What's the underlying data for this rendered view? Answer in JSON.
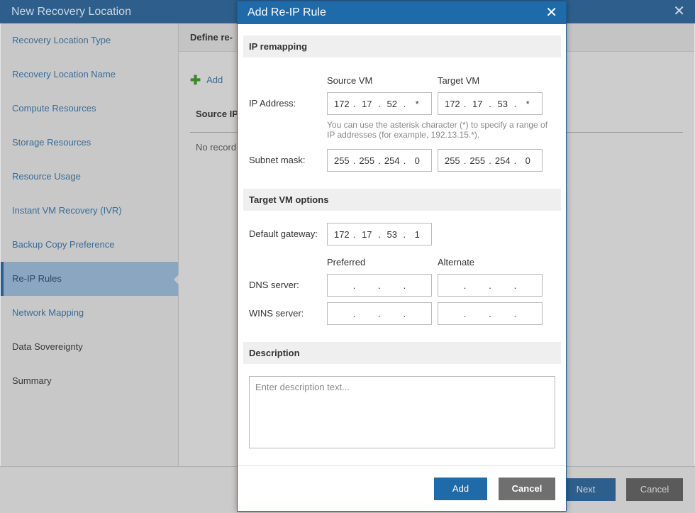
{
  "wizard": {
    "title": "New Recovery Location",
    "close_glyph": "✕",
    "steps": [
      {
        "label": "Recovery Location Type",
        "state": "link"
      },
      {
        "label": "Recovery Location Name",
        "state": "link"
      },
      {
        "label": "Compute Resources",
        "state": "link"
      },
      {
        "label": "Storage Resources",
        "state": "link"
      },
      {
        "label": "Resource Usage",
        "state": "link"
      },
      {
        "label": "Instant VM Recovery (IVR)",
        "state": "link"
      },
      {
        "label": "Backup Copy Preference",
        "state": "link"
      },
      {
        "label": "Re-IP Rules",
        "state": "active"
      },
      {
        "label": "Network Mapping",
        "state": "link"
      },
      {
        "label": "Data Sovereignty",
        "state": "inactive"
      },
      {
        "label": "Summary",
        "state": "inactive"
      }
    ],
    "main": {
      "header": "Define re-",
      "add_label": "Add",
      "column_header": "Source IP",
      "empty_text": "No record"
    },
    "next_label": "Next",
    "cancel_label": "Cancel"
  },
  "dialog": {
    "title": "Add Re-IP Rule",
    "close_glyph": "✕",
    "ip_remapping": {
      "section_title": "IP remapping",
      "source_col": "Source VM",
      "target_col": "Target VM",
      "ip_address_label": "IP Address:",
      "source_ip": [
        "172",
        "17",
        "52",
        "*"
      ],
      "target_ip": [
        "172",
        "17",
        "53",
        "*"
      ],
      "hint": "You can use the asterisk character (*) to specify a range of IP addresses (for example, 192.13.15.*).",
      "subnet_label": "Subnet mask:",
      "source_subnet": [
        "255",
        "255",
        "254",
        "0"
      ],
      "target_subnet": [
        "255",
        "255",
        "254",
        "0"
      ]
    },
    "target_options": {
      "section_title": "Target VM options",
      "gateway_label": "Default gateway:",
      "gateway": [
        "172",
        "17",
        "53",
        "1"
      ],
      "preferred_col": "Preferred",
      "alternate_col": "Alternate",
      "dns_label": "DNS server:",
      "wins_label": "WINS server:"
    },
    "description": {
      "section_title": "Description",
      "placeholder": "Enter description text..."
    },
    "add_label": "Add",
    "cancel_label": "Cancel"
  },
  "colors": {
    "accent": "#1f6aa8",
    "wizard_title_bar": "#2e5f8c",
    "cancel_button": "#6f6f6f"
  }
}
